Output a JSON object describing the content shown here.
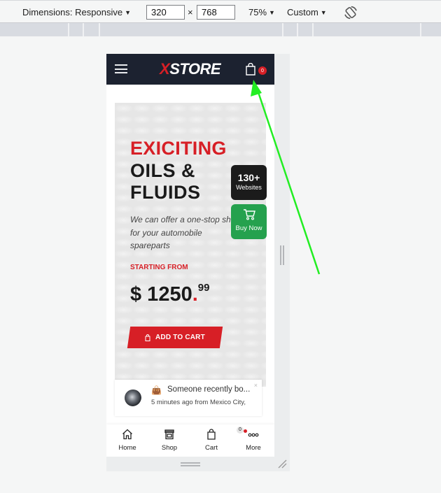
{
  "toolbar": {
    "dimensions_label": "Dimensions: Responsive",
    "width_value": "320",
    "times": "×",
    "height_value": "768",
    "zoom_label": "75%",
    "throttle_label": "Custom",
    "caret": "▼",
    "rotate_icon": "rotate-icon"
  },
  "site": {
    "logo_x": "X",
    "logo_rest": "STORE",
    "cart_count": "0",
    "colors": {
      "brand_red": "#d71f26",
      "header_bg": "#1c2230",
      "buy_green": "#25a14e"
    }
  },
  "hero": {
    "headline_red": "EXICITING",
    "headline_line2": "OILS &",
    "headline_line3": "FLUIDS",
    "desc_line1": "We can offer a one-stop sh",
    "desc_line2": "for your automobile",
    "desc_line3": "spareparts",
    "starting_label": "STARTING FROM",
    "price_main": "$ 1250",
    "price_dot": ".",
    "price_cents": "99",
    "add_to_cart": "ADD TO CART"
  },
  "side_tabs": {
    "websites_count": "130+",
    "websites_label": "Websites",
    "buy_now": "Buy Now"
  },
  "popup": {
    "title": "Someone recently bo...",
    "subtitle": "5 minutes ago from Mexico City,",
    "close": "×"
  },
  "bottom_nav": {
    "items": [
      {
        "label": "Home"
      },
      {
        "label": "Shop"
      },
      {
        "label": "Cart",
        "count": "0"
      },
      {
        "label": "More"
      }
    ]
  }
}
